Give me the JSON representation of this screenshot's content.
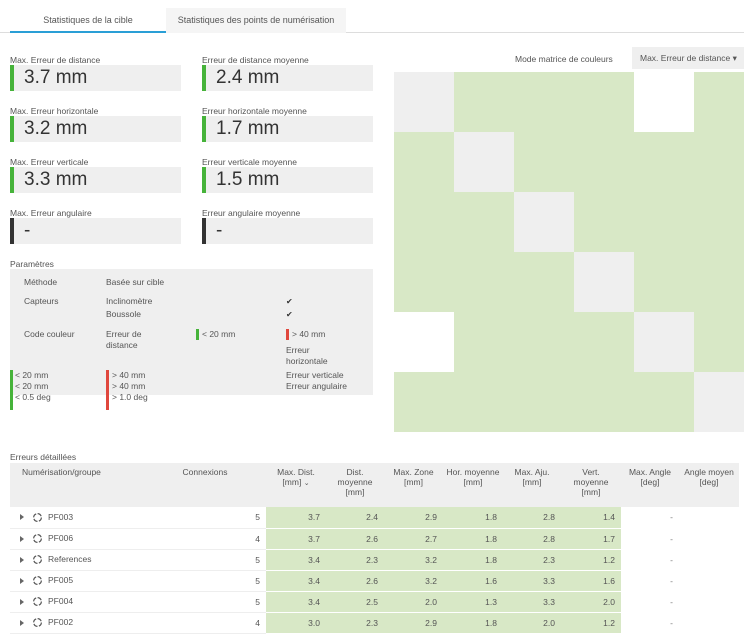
{
  "tabs": [
    "Statistiques de la cible",
    "Statistiques des points de numérisation"
  ],
  "stats": {
    "max_dist": {
      "label": "Max. Erreur de distance",
      "value": "3.7 mm"
    },
    "avg_dist": {
      "label": "Erreur de distance moyenne",
      "value": "2.4 mm"
    },
    "max_hor": {
      "label": "Max. Erreur horizontale",
      "value": "3.2 mm"
    },
    "avg_hor": {
      "label": "Erreur horizontale moyenne",
      "value": "1.7 mm"
    },
    "max_vert": {
      "label": "Max. Erreur verticale",
      "value": "3.3 mm"
    },
    "avg_vert": {
      "label": "Erreur verticale moyenne",
      "value": "1.5 mm"
    },
    "max_ang": {
      "label": "Max. Erreur angulaire",
      "value": "-"
    },
    "avg_ang": {
      "label": "Erreur angulaire moyenne",
      "value": "-"
    }
  },
  "params": {
    "title": "Paramètres",
    "method_label": "Méthode",
    "method_value": "Basée sur cible",
    "sensors_label": "Capteurs",
    "sensor1": "Inclinomètre",
    "sensor2": "Boussole",
    "color_code_label": "Code couleur",
    "color_code_value": "Erreur de distance",
    "dist_low": "< 20 mm",
    "dist_high": "> 40 mm",
    "hor_label": "Erreur horizontale",
    "vert_label": "Erreur verticale",
    "ang_label": "Erreur angulaire",
    "low_list": [
      "< 20 mm",
      "< 20 mm",
      "< 0.5 deg"
    ],
    "high_list": [
      "> 40 mm",
      "> 40 mm",
      "> 1.0 deg"
    ]
  },
  "mode": {
    "label": "Mode matrice de couleurs",
    "value": "Max. Erreur de distance"
  },
  "matrix": [
    [
      "n",
      "g",
      "g",
      "g",
      "w",
      "g"
    ],
    [
      "g",
      "n",
      "g",
      "g",
      "g",
      "g"
    ],
    [
      "g",
      "g",
      "n",
      "g",
      "g",
      "g"
    ],
    [
      "g",
      "g",
      "g",
      "n",
      "g",
      "g"
    ],
    [
      "w",
      "g",
      "g",
      "g",
      "n",
      "g"
    ],
    [
      "g",
      "g",
      "g",
      "g",
      "g",
      "n"
    ]
  ],
  "colors": {
    "green": "#d8e8c6",
    "neutral": "#efefef",
    "white": "#ffffff",
    "accent": "#2a9fd6",
    "bar_green": "#46b33a",
    "bar_red": "#e0473d"
  },
  "detail": {
    "title": "Erreurs détaillées",
    "headers": [
      "Numérisation/groupe",
      "Connexions",
      "Max. Dist. [mm]",
      "Dist. moyenne [mm]",
      "Max. Zone [mm]",
      "Hor. moyenne [mm]",
      "Max. Aju. [mm]",
      "Vert. moyenne [mm]",
      "Max. Angle [deg]",
      "Angle moyen [deg]"
    ],
    "rows": [
      {
        "name": "PF003",
        "conn": "5",
        "v": [
          "3.7",
          "2.4",
          "2.9",
          "1.8",
          "2.8",
          "1.4",
          "-",
          ""
        ]
      },
      {
        "name": "PF006",
        "conn": "4",
        "v": [
          "3.7",
          "2.6",
          "2.7",
          "1.8",
          "2.8",
          "1.7",
          "-",
          ""
        ]
      },
      {
        "name": "References",
        "conn": "5",
        "v": [
          "3.4",
          "2.3",
          "3.2",
          "1.8",
          "2.3",
          "1.2",
          "-",
          ""
        ]
      },
      {
        "name": "PF005",
        "conn": "5",
        "v": [
          "3.4",
          "2.6",
          "3.2",
          "1.6",
          "3.3",
          "1.6",
          "-",
          ""
        ]
      },
      {
        "name": "PF004",
        "conn": "5",
        "v": [
          "3.4",
          "2.5",
          "2.0",
          "1.3",
          "3.3",
          "2.0",
          "-",
          ""
        ]
      },
      {
        "name": "PF002",
        "conn": "4",
        "v": [
          "3.0",
          "2.3",
          "2.9",
          "1.8",
          "2.0",
          "1.2",
          "-",
          ""
        ]
      }
    ]
  }
}
